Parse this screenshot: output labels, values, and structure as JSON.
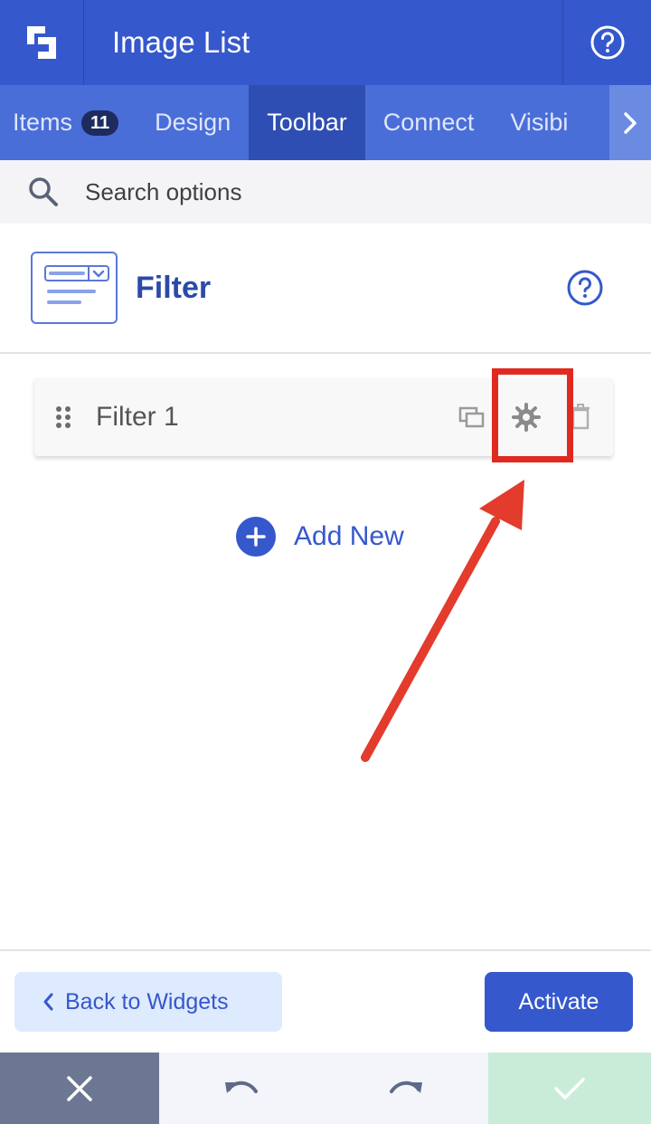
{
  "header": {
    "title": "Image List",
    "logo_icon": "elfsight-logo-icon",
    "help_icon": "help-circle-icon"
  },
  "tabs": [
    {
      "label": "Items",
      "badge": "11",
      "active": false
    },
    {
      "label": "Design",
      "active": false
    },
    {
      "label": "Toolbar",
      "active": true
    },
    {
      "label": "Connect",
      "active": false
    },
    {
      "label": "Visibi",
      "active": false
    }
  ],
  "search": {
    "placeholder": "Search options"
  },
  "section": {
    "title": "Filter"
  },
  "items": [
    {
      "label": "Filter 1"
    }
  ],
  "add_new": {
    "label": "Add New"
  },
  "footer": {
    "back_label": "Back to Widgets",
    "activate_label": "Activate"
  },
  "colors": {
    "primary": "#3558cc",
    "header": "#3558cc",
    "tabs": "#4a6ed8",
    "active_tab": "#2f4eb3",
    "highlight": "#e02a1f",
    "confirm": "#c9ecd9",
    "close": "#6c7893"
  }
}
